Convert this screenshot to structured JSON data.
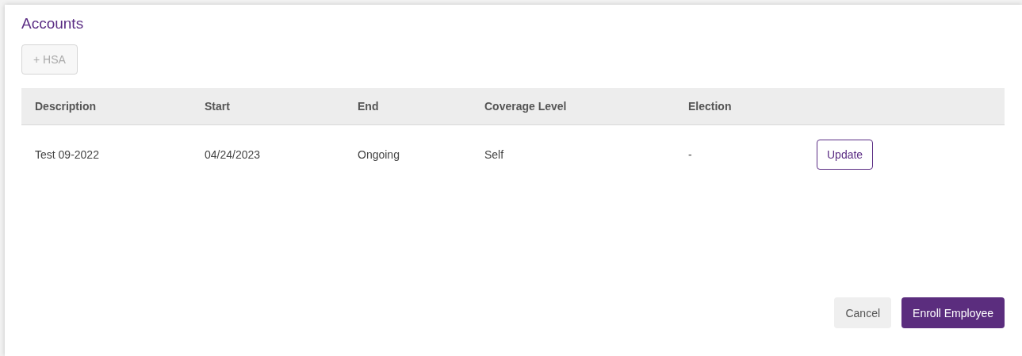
{
  "section": {
    "title": "Accounts"
  },
  "add_button": {
    "label": "+ HSA",
    "disabled": true
  },
  "table": {
    "columns": [
      "Description",
      "Start",
      "End",
      "Coverage Level",
      "Election"
    ],
    "rows": [
      {
        "cells": [
          "Test 09-2022",
          "04/24/2023",
          "Ongoing",
          "Self",
          "-"
        ],
        "action": "Update"
      }
    ]
  },
  "footer_buttons": [
    {
      "label": "Cancel",
      "kind": "secondary"
    },
    {
      "label": "Enroll Employee",
      "kind": "primary"
    }
  ]
}
